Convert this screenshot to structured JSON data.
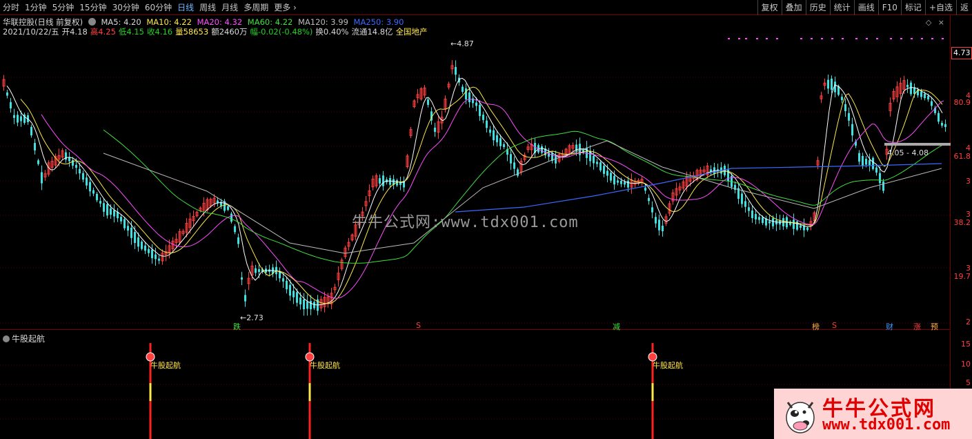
{
  "toolbar": {
    "periods": [
      "分时",
      "1分钟",
      "5分钟",
      "15分钟",
      "30分钟",
      "60分钟",
      "日线",
      "周线",
      "月线",
      "多周期",
      "更多"
    ],
    "active_period": "日线",
    "right_buttons": [
      "复权",
      "叠加",
      "历史",
      "统计",
      "画线",
      "F10",
      "标记",
      "+自选",
      "返"
    ]
  },
  "stock": {
    "title": "华联控股(日线 前复权)",
    "ma5": "MA5: 4.20",
    "ma10": "MA10: 4.22",
    "ma20": "MA20: 4.32",
    "ma60": "MA60: 4.22",
    "ma120": "MA120: 3.99",
    "ma250": "MA250: 3.90"
  },
  "quote": {
    "date": "2021/10/22/五",
    "open_label": "开",
    "open": "4.18",
    "high_label": "高",
    "high": "4.25",
    "low_label": "低",
    "low": "4.15",
    "close_label": "收",
    "close": "4.16",
    "volume_label": "量",
    "volume": "58653",
    "amount_label": "额",
    "amount": "2460万",
    "change_label": "幅",
    "change": "-0.02(-0.48%)",
    "turnover_label": "换",
    "turnover": "0.40%",
    "float_label": "流通",
    "float_value": "14.8亿",
    "sector": "全国地产"
  },
  "annotations": {
    "high_point": "4.87",
    "low_point": "2.73",
    "range_label": "4.05 - 4.08"
  },
  "markers": {
    "die": "跌",
    "s1": "S",
    "jian": "减",
    "bang": "榜",
    "s2": "S",
    "cai": "财",
    "zhang": "涨",
    "yu": "预"
  },
  "axis": {
    "current_price": "4.73",
    "labels": [
      "4",
      "80.9",
      "4",
      "61.8",
      "3",
      "3",
      "38.2",
      "3",
      "19.7",
      "2"
    ],
    "sub_labels": [
      "15",
      "10",
      "5"
    ]
  },
  "watermark": "牛牛公式网:www.tdx001.com",
  "sub_panel": {
    "title": "牛股起航",
    "event_label": "牛股起航"
  },
  "logo": {
    "title": "牛牛公式网",
    "url": "www.tdx001.com"
  },
  "colors": {
    "up": "#ff4040",
    "down": "#40e0e0",
    "ma5": "#ffffff",
    "ma10": "#ffe84a",
    "ma20": "#ff4cff",
    "ma60": "#40e040",
    "ma120": "#bbbbbb",
    "ma250": "#3a6aff"
  }
}
